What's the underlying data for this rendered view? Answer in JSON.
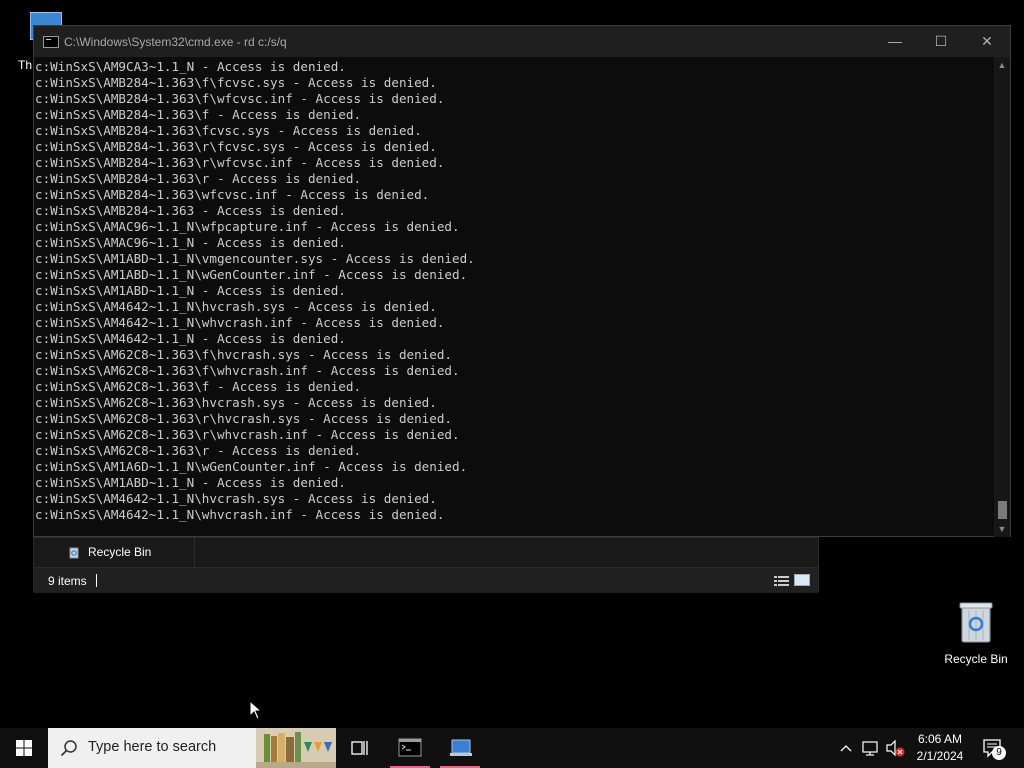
{
  "desktop": {
    "partial_icon_label": "Th",
    "recycle_bin_label": "Recycle Bin"
  },
  "cmd": {
    "title": "C:\\Windows\\System32\\cmd.exe - rd  c:/s/q",
    "controls": {
      "minimize": "—",
      "maximize": "☐",
      "close": "✕"
    },
    "lines": [
      "c:WinSxS\\AM9CA3~1.1_N - Access is denied.",
      "c:WinSxS\\AMB284~1.363\\f\\fcvsc.sys - Access is denied.",
      "c:WinSxS\\AMB284~1.363\\f\\wfcvsc.inf - Access is denied.",
      "c:WinSxS\\AMB284~1.363\\f - Access is denied.",
      "c:WinSxS\\AMB284~1.363\\fcvsc.sys - Access is denied.",
      "c:WinSxS\\AMB284~1.363\\r\\fcvsc.sys - Access is denied.",
      "c:WinSxS\\AMB284~1.363\\r\\wfcvsc.inf - Access is denied.",
      "c:WinSxS\\AMB284~1.363\\r - Access is denied.",
      "c:WinSxS\\AMB284~1.363\\wfcvsc.inf - Access is denied.",
      "c:WinSxS\\AMB284~1.363 - Access is denied.",
      "c:WinSxS\\AMAC96~1.1_N\\wfpcapture.inf - Access is denied.",
      "c:WinSxS\\AMAC96~1.1_N - Access is denied.",
      "c:WinSxS\\AM1ABD~1.1_N\\vmgencounter.sys - Access is denied.",
      "c:WinSxS\\AM1ABD~1.1_N\\wGenCounter.inf - Access is denied.",
      "c:WinSxS\\AM1ABD~1.1_N - Access is denied.",
      "c:WinSxS\\AM4642~1.1_N\\hvcrash.sys - Access is denied.",
      "c:WinSxS\\AM4642~1.1_N\\whvcrash.inf - Access is denied.",
      "c:WinSxS\\AM4642~1.1_N - Access is denied.",
      "c:WinSxS\\AM62C8~1.363\\f\\hvcrash.sys - Access is denied.",
      "c:WinSxS\\AM62C8~1.363\\f\\whvcrash.inf - Access is denied.",
      "c:WinSxS\\AM62C8~1.363\\f - Access is denied.",
      "c:WinSxS\\AM62C8~1.363\\hvcrash.sys - Access is denied.",
      "c:WinSxS\\AM62C8~1.363\\r\\hvcrash.sys - Access is denied.",
      "c:WinSxS\\AM62C8~1.363\\r\\whvcrash.inf - Access is denied.",
      "c:WinSxS\\AM62C8~1.363\\r - Access is denied.",
      "c:WinSxS\\AM1A6D~1.1_N\\wGenCounter.inf - Access is denied.",
      "c:WinSxS\\AM1ABD~1.1_N - Access is denied.",
      "c:WinSxS\\AM4642~1.1_N\\hvcrash.sys - Access is denied.",
      "c:WinSxS\\AM4642~1.1_N\\whvcrash.inf - Access is denied."
    ]
  },
  "explorer": {
    "nav_item": "Recycle Bin",
    "status_items": "9 items"
  },
  "taskbar": {
    "search_placeholder": "Type here to search",
    "clock_time": "6:06 AM",
    "clock_date": "2/1/2024",
    "notification_count": "9"
  }
}
